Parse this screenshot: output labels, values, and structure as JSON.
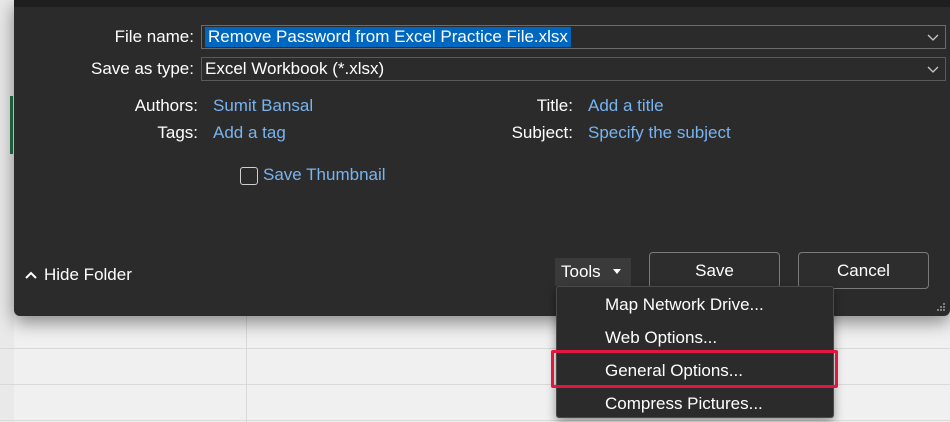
{
  "dialog": {
    "file_name_label": "File name:",
    "file_name_value": "Remove Password from Excel Practice File.xlsx",
    "save_as_type_label": "Save as type:",
    "save_as_type_value": "Excel Workbook (*.xlsx)",
    "authors_label": "Authors:",
    "authors_value": "Sumit Bansal",
    "tags_label": "Tags:",
    "tags_value": "Add a tag",
    "title_label": "Title:",
    "title_value": "Add a title",
    "subject_label": "Subject:",
    "subject_value": "Specify the subject",
    "save_thumbnail_label": "Save Thumbnail",
    "save_thumbnail_checked": false,
    "hide_folders_label": "Hide Folder",
    "tools_label": "Tools",
    "save_label": "Save",
    "cancel_label": "Cancel"
  },
  "tools_menu": {
    "items": [
      {
        "label": "Map Network Drive..."
      },
      {
        "label": "Web Options..."
      },
      {
        "label": "General Options...",
        "highlighted": true
      },
      {
        "label": "Compress Pictures..."
      }
    ]
  },
  "colors": {
    "dialog_bg": "#2b2b2b",
    "link": "#78b4f0",
    "selection": "#0067c0",
    "highlight_border": "#e4163f"
  }
}
